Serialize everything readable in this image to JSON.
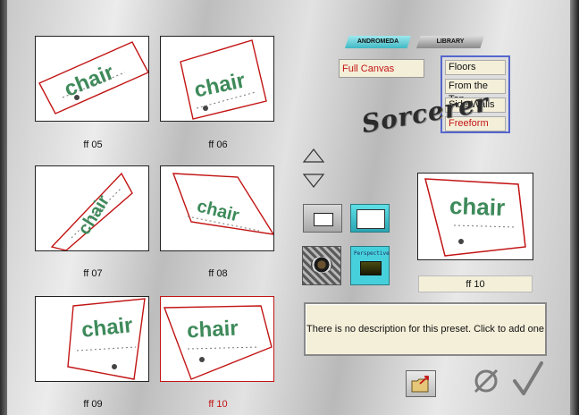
{
  "presets": [
    {
      "caption": "ff 05",
      "word": "chair",
      "selected": false
    },
    {
      "caption": "ff 06",
      "word": "chair",
      "selected": false
    },
    {
      "caption": "ff 07",
      "word": "chair",
      "selected": false
    },
    {
      "caption": "ff 08",
      "word": "chair",
      "selected": false
    },
    {
      "caption": "ff 09",
      "word": "chair",
      "selected": false
    },
    {
      "caption": "ff 10",
      "word": "chair",
      "selected": true
    }
  ],
  "tabs": {
    "andromeda": "ANDROMEDA",
    "library": "LIBRARY"
  },
  "canvas_mode": "Full Canvas",
  "categories": [
    {
      "label": "Floors",
      "selected": false
    },
    {
      "label": "From the Top",
      "selected": false
    },
    {
      "label": "Side Walls",
      "selected": false
    },
    {
      "label": "Freeform",
      "selected": true
    }
  ],
  "logo_text": "Sorcerer",
  "tool_buttons": {
    "perspective_label": "Perspective"
  },
  "preview": {
    "word": "chair",
    "name": "ff 10"
  },
  "description": "There is no description for this preset. Click to add one",
  "colors": {
    "selected_red": "#c21414",
    "accent_cyan": "#3fb8c3",
    "list_border": "#5566cc",
    "field_bg": "#f4efd9"
  }
}
